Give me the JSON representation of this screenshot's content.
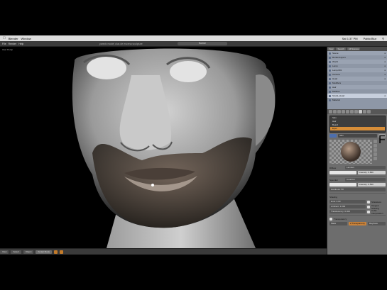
{
  "menubar": {
    "app": "Blender",
    "menu": "Window",
    "clock": "Sat 1:37 PM",
    "user": "Pablo Blur"
  },
  "header": {
    "menu_file": "File",
    "menu_render": "Render",
    "menu_help": "Help",
    "scene": "Scene",
    "title_text": "yaredv model olus de escena sculpture"
  },
  "viewport": {
    "info": "User Persp"
  },
  "footer": {
    "view": "View",
    "select": "Select",
    "object": "Object",
    "mode": "Sculpt Mode"
  },
  "outliner": {
    "view": "View",
    "search": "Search",
    "all_scenes": "All Scenes",
    "rows": [
      {
        "name": "Scene"
      },
      {
        "name": "RenderLayers"
      },
      {
        "name": "World"
      },
      {
        "name": "Lamp"
      },
      {
        "name": "Lamp.001"
      },
      {
        "name": "Camera"
      },
      {
        "name": "Head"
      },
      {
        "name": "Modifiers"
      },
      {
        "name": "Hair"
      },
      {
        "name": "Multires"
      },
      {
        "name": "Sculpt_Head"
      },
      {
        "name": "Material"
      }
    ]
  },
  "material": {
    "slots": [
      "Skin",
      "Hair",
      "Beard",
      "Eyes",
      "Material"
    ],
    "name": "Skin",
    "data": "F",
    "diffuse": "Diffuse",
    "lambert": "Lambert",
    "intensity": "Intensity: 0.800",
    "specular": "Specular",
    "cooktorr": "CookTorr",
    "spec_intensity": "Intensity: 0.500",
    "hardness": "Hardness: 50",
    "shading": "Shading",
    "emit": "Emit: 0.00",
    "ambient": "Ambient: 1.000",
    "translucency": "Translucency: 0.000",
    "shadeless": "Shadeless",
    "tangent": "Tangent Shading",
    "cubic": "Cubic Interpolation",
    "transparency": "Transparency",
    "mask": "Mask",
    "ztransp": "Z Transparency",
    "raytrace": "Raytrace"
  }
}
